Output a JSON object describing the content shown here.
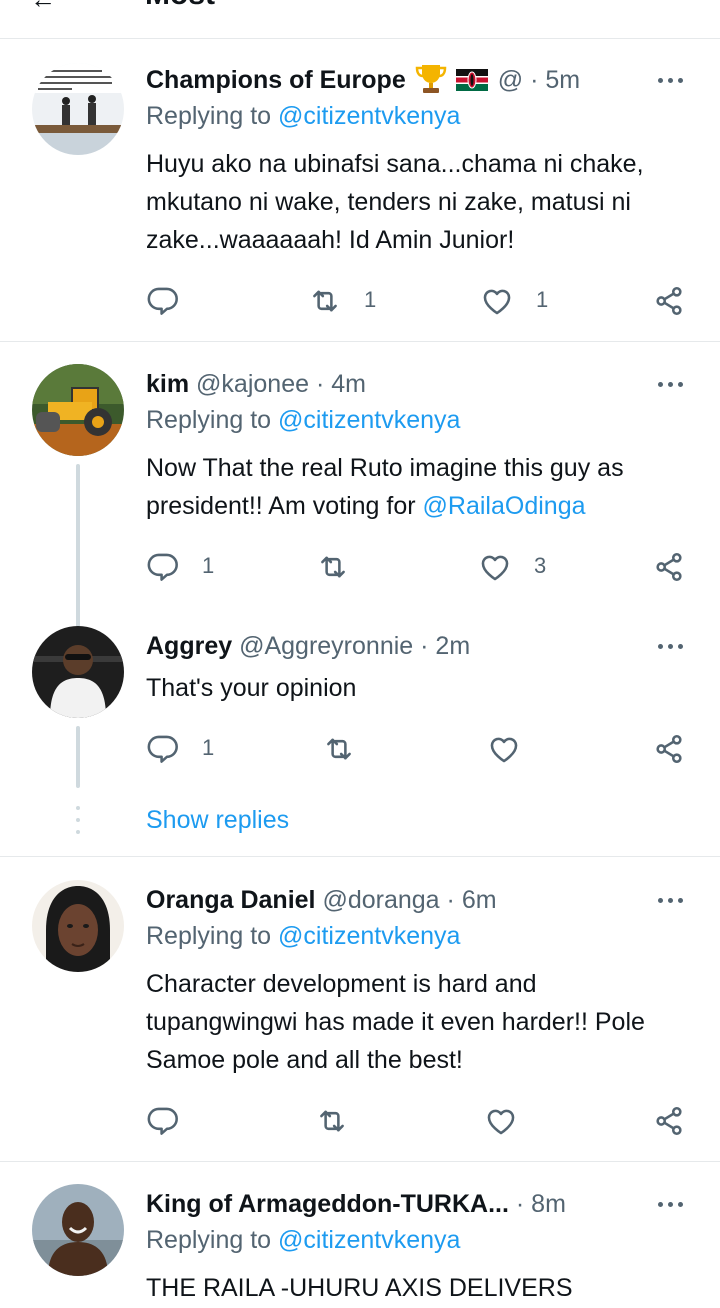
{
  "header": {
    "back_glyph": "←",
    "title": "Most"
  },
  "tweets": [
    {
      "name": "Champions of Europe",
      "name_icons": [
        "trophy-emoji",
        "kenya-flag-emoji"
      ],
      "handle": "@",
      "time": "· 5m",
      "replying_label": "Replying to",
      "replying_to": "@citizentvkenya",
      "body": "Huyu ako na ubinafsi sana...chama ni chake, mkutano ni wake, tenders ni zake, matusi ni zake...waaaaaah! Id Amin Junior!",
      "replies": "",
      "retweets": "1",
      "likes": "1"
    },
    {
      "name": "kim",
      "handle": "@kajonee",
      "time": "· 4m",
      "replying_label": "Replying to",
      "replying_to": "@citizentvkenya",
      "body_text": "Now That the real Ruto imagine this guy as president!!  Am voting for ",
      "body_mention": "@RailaOdinga",
      "replies": "1",
      "retweets": "",
      "likes": "3"
    },
    {
      "name": "Aggrey",
      "handle": "@Aggreyronnie",
      "time": "· 2m",
      "body": "That's your opinion",
      "replies": "1",
      "retweets": "",
      "likes": ""
    },
    {
      "name": "Oranga Daniel",
      "handle": "@doranga",
      "time": "· 6m",
      "replying_label": "Replying to",
      "replying_to": "@citizentvkenya",
      "body": "Character development is hard and tupangwingwi has made it even harder!! Pole Samoe pole and all the best!",
      "replies": "",
      "retweets": "",
      "likes": ""
    },
    {
      "name": "King of Armageddon-TURKA...",
      "handle": "",
      "time": "· 8m",
      "replying_label": "Replying to",
      "replying_to": "@citizentvkenya",
      "body": "THE RAILA -UHURU AXIS DELIVERS"
    }
  ],
  "show_replies": "Show replies",
  "colors": {
    "accent": "#1d9bf0",
    "secondary": "#536471",
    "divider": "#e6e9eb",
    "thread_line": "#cfd9de"
  },
  "icons": [
    "reply-icon",
    "retweet-icon",
    "like-icon",
    "share-icon",
    "more-icon"
  ]
}
